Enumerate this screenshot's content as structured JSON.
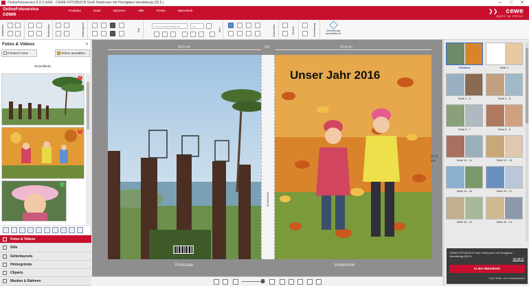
{
  "window": {
    "title": "OnlineFotoservice 6.2.0 (x64) - CEWE FOTOBUCH Groß Hardcover mit Hochglanz-Veredelung (26.5.)",
    "controls": [
      "—",
      "□",
      "✕"
    ]
  },
  "brand": {
    "line1": "OnlineFotoservice",
    "line2": "cewe"
  },
  "menu": [
    "Produkte",
    "Datei",
    "Optionen",
    "Hilfe",
    "Preise",
    "Warenkorb"
  ],
  "logo": {
    "name": "cewe",
    "tagline": "BEST IN PRINT"
  },
  "toolbar": {
    "labels": [
      "Allgemein",
      "Bearbeiten",
      "Hintergrund",
      "Text",
      "Bild",
      "Dekoration",
      "Ordnen",
      "Veredelung"
    ],
    "font_placeholder": "Frieze Malerei/Bahne",
    "size_placeholder": "18",
    "veredelung_label": "Veredelung auswählen ▾"
  },
  "left_panel": {
    "title": "Fotos & Videos",
    "button_folder": "Fotobuch Fotos",
    "button_selector": "Ordner auswählen",
    "section_label": "Bestellbilder",
    "thumbs": [
      {
        "name": "palm-tree-photo",
        "badge": "2"
      },
      {
        "name": "kids-in-leaves-photo",
        "badge": "1"
      },
      {
        "name": "girl-with-hat-photo",
        "badge": "✓"
      }
    ],
    "accordion": [
      "Fotos & Videos",
      "Stile",
      "Seitenlayouts",
      "Hintergründe",
      "Cliparts",
      "Masken & Rahmen"
    ]
  },
  "canvas": {
    "back_width": "20,9 cm",
    "spine_width": "0,8",
    "front_width": "20,9 cm",
    "height": "27,5 cm",
    "cover_title": "Unser Jahr 2016",
    "spine_text": "Buchrücken",
    "back_label": "Rückseite",
    "front_label": "Vorderseite"
  },
  "pages": [
    {
      "label": "Einband",
      "selected": true
    },
    {
      "label": "Seite 1",
      "selected": false
    },
    {
      "label": "Seite 2 - 3",
      "selected": false
    },
    {
      "label": "Seite 4 - 5",
      "selected": false
    },
    {
      "label": "Seite 6 - 7",
      "selected": false
    },
    {
      "label": "Seite 8 - 9",
      "selected": false
    },
    {
      "label": "Seite 10 - 11",
      "selected": false
    },
    {
      "label": "Seite 12 - 13",
      "selected": false
    },
    {
      "label": "Seite 14 - 15",
      "selected": false
    },
    {
      "label": "Seite 16 - 17",
      "selected": false
    },
    {
      "label": "Seite 18 - 19",
      "selected": false
    },
    {
      "label": "Seite 20 - 21",
      "selected": false
    }
  ],
  "order": {
    "description": "CEWE FOTOBUCH Groß Hardcover mit Hochglanz-Veredelung (26.5.)",
    "price": "35,95 €*",
    "button": "In den Warenkorb",
    "note": "* Inkl. MwSt. und Versandkosten"
  },
  "colors": {
    "brand_red": "#c8102e",
    "selected_blue": "#2d6fd0"
  }
}
